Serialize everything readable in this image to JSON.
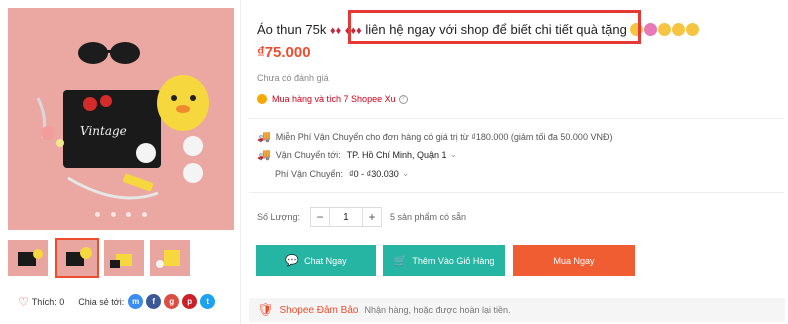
{
  "product": {
    "title_start": "Áo thun 75k",
    "title_highlight": "liên hệ ngay với shop để biết chi tiết",
    "title_end": "quà tặng",
    "price": "₫75.000",
    "rating_text": "Chưa có đánh giá",
    "coins_text": "Mua hàng và tích 7 Shopee Xu",
    "main_image_caption": "Vintage"
  },
  "shipping": {
    "free_text": "Miễn Phí Vận Chuyển cho đơn hàng có giá trị từ ₫180.000 (giảm tối đa 50.000 VNĐ)",
    "to_label": "Vận Chuyển tới:",
    "to_value": "TP. Hồ Chí Minh, Quận 1",
    "fee_label": "Phí Vận Chuyển:",
    "fee_value": "₫0 - ₫30.030"
  },
  "quantity": {
    "label": "Số Lượng:",
    "minus": "−",
    "value": "1",
    "plus": "+",
    "stock": "5 sản phẩm có sẵn"
  },
  "actions": {
    "chat": "Chat Ngay",
    "add_to_cart": "Thêm Vào Giỏ Hàng",
    "buy_now": "Mua Ngay"
  },
  "social": {
    "like_label": "Thích: 0",
    "share_label": "Chia sẻ tới:",
    "networks": [
      "messenger-icon",
      "facebook-icon",
      "google-plus-icon",
      "pinterest-icon",
      "twitter-icon"
    ]
  },
  "guarantee": {
    "title": "Shopee Đảm Bảo",
    "text": "Nhận hàng, hoặc được hoàn lại tiền."
  },
  "colors": {
    "brand": "#ee4d2d",
    "teal": "#26b5a3",
    "highlight_box": "#e53935"
  }
}
